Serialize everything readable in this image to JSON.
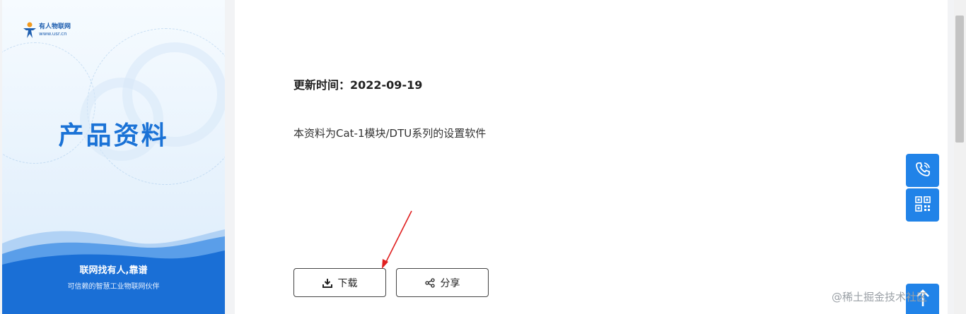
{
  "banner": {
    "logo_name": "有人物联网",
    "logo_url": "www.usr.cn",
    "title": "产品资料",
    "slogan": "联网找有人,靠谱",
    "slogan_sub": "可信赖的智慧工业物联网伙伴"
  },
  "content": {
    "update_time": "更新时间：2022-09-19",
    "description": "本资料为Cat-1模块/DTU系列的设置软件"
  },
  "actions": {
    "download_label": "下载",
    "share_label": "分享"
  },
  "floating": {
    "phone_icon": "phone-icon",
    "qr_icon": "qr-code-icon",
    "top_icon": "arrow-up-icon"
  },
  "watermark": "@稀土掘金技术社区",
  "colors": {
    "accent": "#2183e8",
    "title_blue": "#1a72d6",
    "annotation_arrow": "#e02020"
  }
}
